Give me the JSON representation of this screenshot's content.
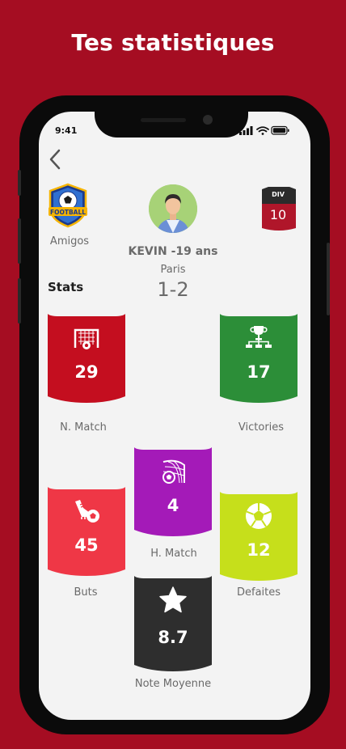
{
  "headline": "Tes statistiques",
  "status_bar": {
    "time": "9:41"
  },
  "club": {
    "name": "Amigos",
    "logo_text": "FOOTBALL"
  },
  "player": {
    "name": "KEVIN -19 ans",
    "city": "Paris",
    "score": "1-2"
  },
  "division": {
    "label": "DIV",
    "value": "10"
  },
  "stats_title": "Stats",
  "stats": {
    "matches": {
      "label": "N. Match",
      "value": "29",
      "color": "#c40e1f",
      "icon": "goal-net-icon"
    },
    "victories": {
      "label": "Victories",
      "value": "17",
      "color": "#2c8e38",
      "icon": "trophy-bracket-icon"
    },
    "h_match": {
      "label": "H. Match",
      "value": "4",
      "color": "#a41ab8",
      "icon": "ball-in-net-icon"
    },
    "goals": {
      "label": "Buts",
      "value": "45",
      "color": "#ef3746",
      "icon": "boot-and-ball-icon"
    },
    "defeats": {
      "label": "Defaites",
      "value": "12",
      "color": "#c6df1b",
      "icon": "soccer-ball-icon"
    },
    "rating": {
      "label": "Note Moyenne",
      "value": "8.7",
      "color": "#2e2e2e",
      "icon": "star-icon"
    }
  }
}
